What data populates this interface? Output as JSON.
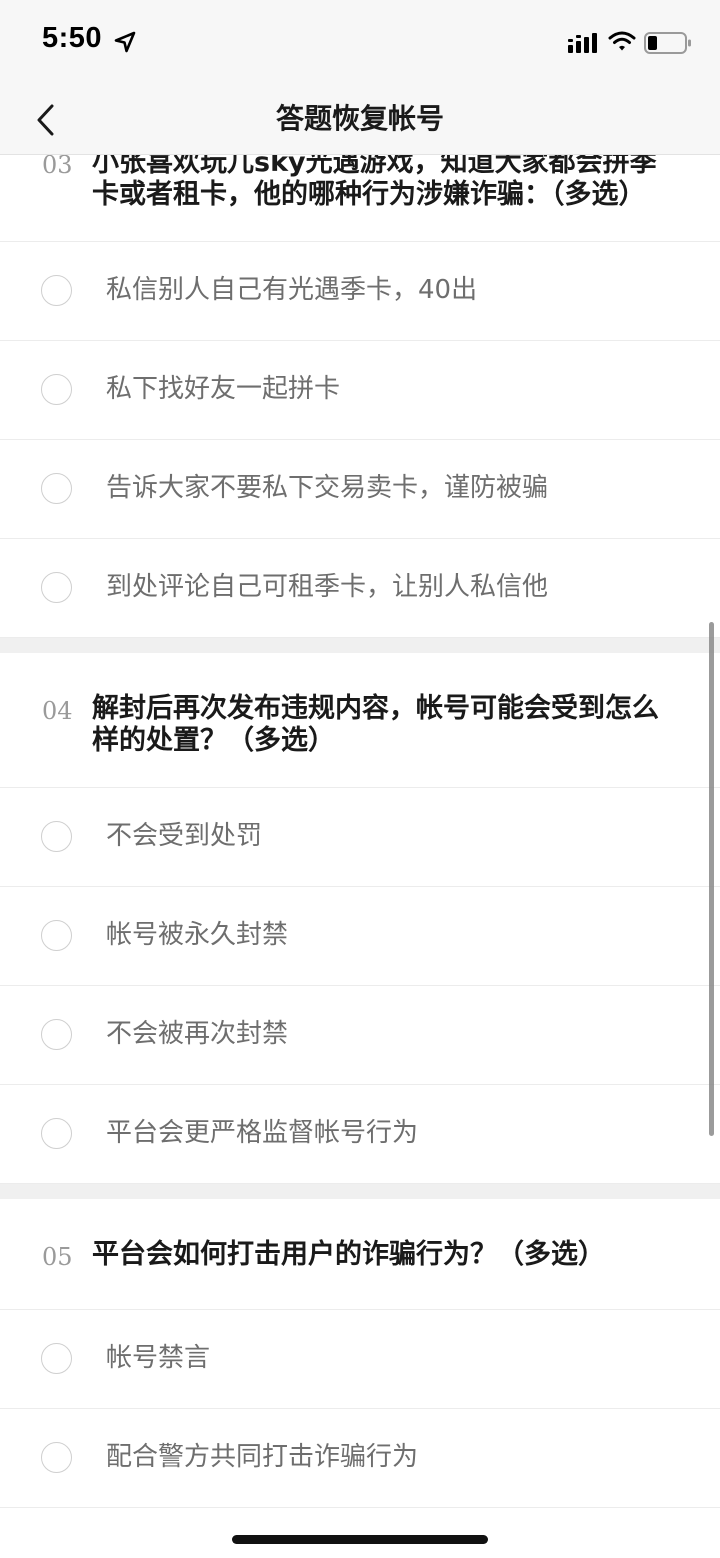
{
  "status_bar": {
    "time": "5:50"
  },
  "nav": {
    "title": "答题恢复帐号"
  },
  "questions": [
    {
      "number": "03",
      "text": "小张喜欢玩儿sky光遇游戏，知道大家都会拼季卡或者租卡，他的哪种行为涉嫌诈骗：（多选）",
      "options": [
        "私信别人自己有光遇季卡，40出",
        "私下找好友一起拼卡",
        "告诉大家不要私下交易卖卡，谨防被骗",
        "到处评论自己可租季卡，让别人私信他"
      ]
    },
    {
      "number": "04",
      "text": "解封后再次发布违规内容，帐号可能会受到怎么样的处置？（多选）",
      "options": [
        "不会受到处罚",
        "帐号被永久封禁",
        "不会被再次封禁",
        "平台会更严格监督帐号行为"
      ]
    },
    {
      "number": "05",
      "text": "平台会如何打击用户的诈骗行为？（多选）",
      "options": [
        "帐号禁言",
        "配合警方共同打击诈骗行为"
      ]
    }
  ],
  "colors": {
    "bar_background": "#f7f7f7",
    "question_text": "#1a1a1a",
    "option_text": "#6e6e6e",
    "number_text": "#9a9a9a",
    "divider": "#ececec",
    "section_gap": "#f0f0f0"
  },
  "icons": {
    "back": "chevron-left-icon",
    "location": "location-arrow-icon",
    "signal": "cellular-signal-icon",
    "wifi": "wifi-icon",
    "battery": "battery-icon"
  }
}
